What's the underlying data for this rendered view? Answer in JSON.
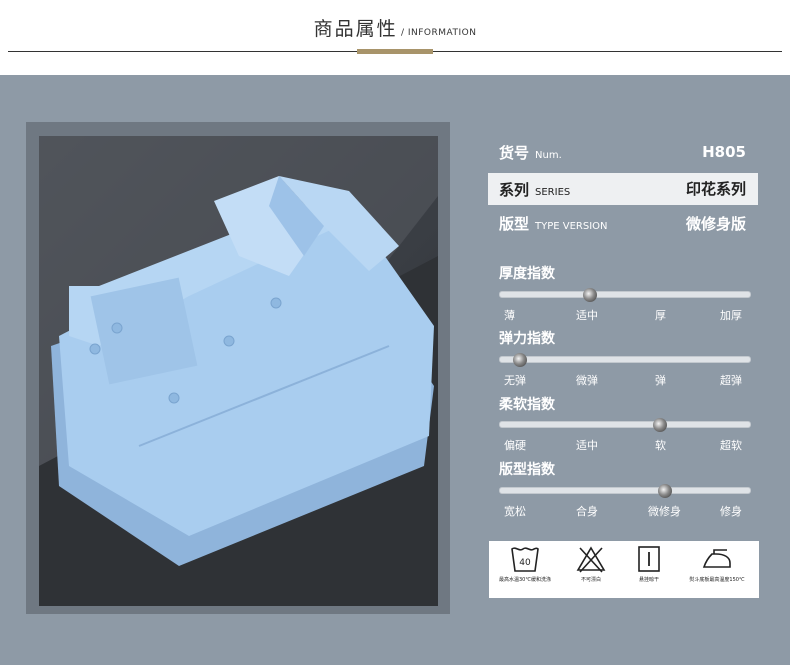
{
  "header": {
    "title_cn": "商品属性",
    "sep": " / ",
    "title_en": "INFORMATION"
  },
  "info_rows": [
    {
      "label_cn": "货号",
      "label_en": "Num.",
      "value": "H805"
    },
    {
      "label_cn": "系列",
      "label_en": "SERIES",
      "value": "印花系列"
    },
    {
      "label_cn": "版型",
      "label_en": "TYPE VERSION",
      "value": "微修身版"
    }
  ],
  "indices": [
    {
      "title": "厚度指数",
      "ticks": [
        "薄",
        "适中",
        "厚",
        "加厚"
      ],
      "level": 0.36
    },
    {
      "title": "弹力指数",
      "ticks": [
        "无弹",
        "微弹",
        "弹",
        "超弹"
      ],
      "level": 0.08
    },
    {
      "title": "柔软指数",
      "ticks": [
        "偏硬",
        "适中",
        "软",
        "超软"
      ],
      "level": 0.64
    },
    {
      "title": "版型指数",
      "ticks": [
        "宽松",
        "合身",
        "微修身",
        "修身"
      ],
      "level": 0.66
    }
  ],
  "care": [
    {
      "icon": "wash-40-icon",
      "number": "40",
      "caption": "最高水温30℃缓和洗涤"
    },
    {
      "icon": "no-bleach-icon",
      "caption": "不可漂白"
    },
    {
      "icon": "hang-dry-icon",
      "caption": "悬挂晾干"
    },
    {
      "icon": "iron-icon",
      "caption": "熨斗底板最高温度150℃"
    }
  ],
  "colors": {
    "panel": "#8e9aa6",
    "accent": "#a8946a",
    "shirt": "#a9cdef"
  }
}
